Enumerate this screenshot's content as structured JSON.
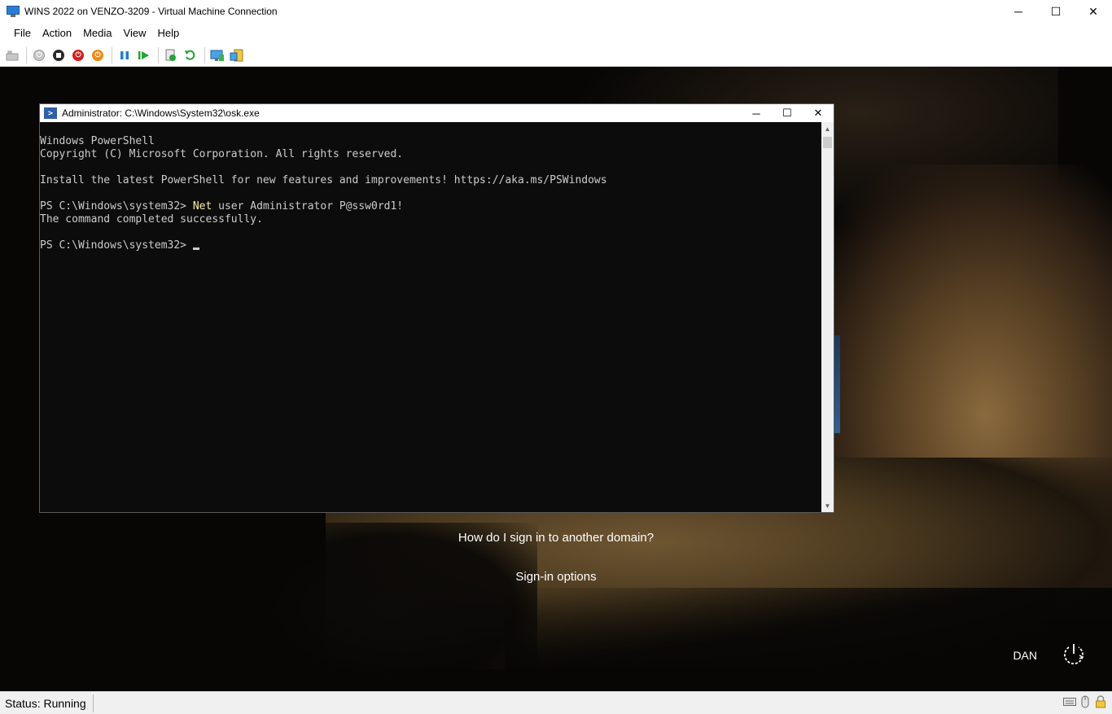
{
  "window": {
    "title": "WINS 2022 on VENZO-3209 - Virtual Machine Connection",
    "minimize": "─",
    "maximize": "☐",
    "close": "✕"
  },
  "menu": {
    "items": [
      "File",
      "Action",
      "Media",
      "View",
      "Help"
    ]
  },
  "toolbar": {
    "buttons": [
      "ctrl-alt-del-icon",
      "start-icon",
      "turn-off-icon",
      "shut-down-icon",
      "save-icon",
      "pause-icon",
      "reset-icon",
      "checkpoint-icon",
      "revert-icon",
      "enhanced-session-icon",
      "share-icon"
    ]
  },
  "powershell": {
    "title": "Administrator: C:\\Windows\\System32\\osk.exe",
    "minimize": "─",
    "maximize": "☐",
    "close": "✕",
    "lines": [
      "Windows PowerShell",
      "Copyright (C) Microsoft Corporation. All rights reserved.",
      "",
      "Install the latest PowerShell for new features and improvements! https://aka.ms/PSWindows",
      "",
      "PS C:\\Windows\\system32> ",
      "The command completed successfully.",
      "",
      "PS C:\\Windows\\system32> "
    ],
    "command_keyword": "Net",
    "command_rest": " user Administrator P@ssw0rd1!",
    "scroll_up": "▲",
    "scroll_down": "▼"
  },
  "lockscreen": {
    "link_domain": "How do I sign in to another domain?",
    "link_options": "Sign-in options",
    "language": "DAN"
  },
  "status": {
    "text": "Status: Running"
  },
  "colors": {
    "console_bg": "#0c0c0c",
    "console_text": "#cccccc",
    "command_highlight": "#f9f1a5"
  }
}
